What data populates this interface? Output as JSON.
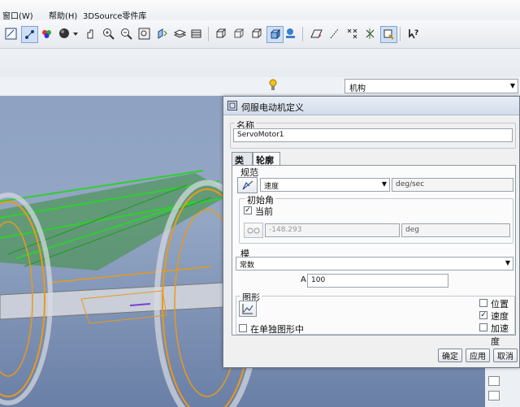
{
  "menu": {
    "window": "窗口(W)",
    "help": "帮助(H)",
    "lib": "3DSource零件库"
  },
  "toolbar": {
    "icons": [
      "sketch-icon",
      "datum-display-icon",
      "color-icon",
      "shading-icon",
      "spin-icon",
      "zoom-in-icon",
      "zoom-out-icon",
      "refit-icon",
      "orient-icon",
      "layers-icon",
      "view-box-icon",
      "view-box2-icon",
      "view-box3-icon",
      "shaded-view-icon",
      "model-tree-icon",
      "plane-display-icon",
      "axis-display-icon",
      "point-display-icon",
      "csys-display-icon",
      "annotation-display-icon",
      "whats-this-icon"
    ]
  },
  "mode_combo": {
    "value": "机构"
  },
  "dialog": {
    "title": "伺服电动机定义",
    "name_label": "名称",
    "name_value": "ServoMotor1",
    "tabs": [
      "类型",
      "轮廓"
    ],
    "spec_label": "规范",
    "spec_type": "速度",
    "spec_unit": "deg/sec",
    "initial_angle_label": "初始角",
    "current_label": "当前",
    "current_checked": true,
    "angle_value": "-148.293",
    "angle_unit": "deg",
    "module_label": "模",
    "module_value": "常数",
    "a_label": "A",
    "a_value": "100",
    "graph_label": "图形",
    "separate_label": "在单独图形中",
    "position_label": "位置",
    "velocity_label": "速度",
    "accel_label": "加速度",
    "position_checked": false,
    "velocity_checked": true,
    "accel_checked": false,
    "ok": "确定",
    "apply": "应用",
    "cancel": "取消"
  },
  "colors": {
    "model_wire": "#e89a1a",
    "highlight": "#2fcf2f",
    "background": "#8fa2c2"
  }
}
